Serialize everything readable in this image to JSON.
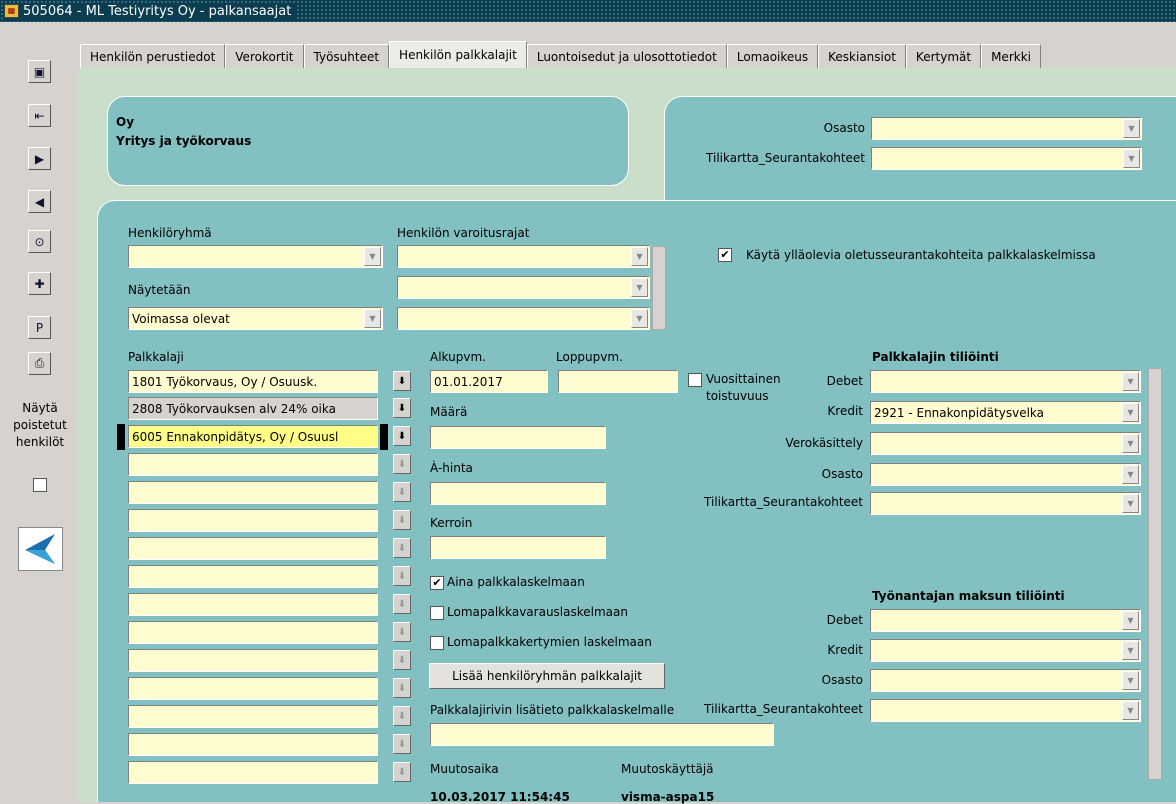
{
  "window": {
    "title": "505064 - ML Testiyritys Oy - palkansaajat"
  },
  "tabs": [
    "Henkilön perustiedot",
    "Verokortit",
    "Työsuhteet",
    "Henkilön palkkalajit",
    "Luontoisedut ja ulosottotiedot",
    "Lomaoikeus",
    "Keskiansiot",
    "Kertymät",
    "Merkki"
  ],
  "toolbar": {
    "icons": [
      "save-icon",
      "exit-icon",
      "next-icon",
      "previous-icon",
      "query-icon",
      "new-record-icon",
      "p-icon",
      "print-icon"
    ],
    "p_label": "P"
  },
  "left": {
    "show_deleted_line1": "Näytä",
    "show_deleted_line2": "poistetut",
    "show_deleted_line3": "henkilöt"
  },
  "company": {
    "line1": "Oy",
    "line2": "Yritys ja työkorvaus"
  },
  "header_right": {
    "osasto_label": "Osasto",
    "osasto_value": "",
    "tilikartta_label": "Tilikartta_Seurantakohteet",
    "tilikartta_value": ""
  },
  "filters": {
    "henkiloryhma_label": "Henkilöryhmä",
    "henkiloryhma_value": "",
    "varoitusrajat_label": "Henkilön varoitusrajat",
    "naytetaan_label": "Näytetään",
    "naytetaan_value": "Voimassa olevat",
    "use_defaults_label": "Käytä ylläolevia oletusseurantakohteita palkkalaskelmissa",
    "use_defaults_checked": true
  },
  "palkkalaji": {
    "label": "Palkkalaji",
    "rows": [
      "1801 Työkorvaus, Oy / Osuusk.",
      "2808 Työkorvauksen alv 24% oika",
      "6005 Ennakonpidätys, Oy / Osuusl",
      "",
      "",
      "",
      "",
      "",
      "",
      "",
      "",
      "",
      "",
      "",
      ""
    ]
  },
  "detail": {
    "alkupvm_label": "Alkupvm.",
    "alkupvm_value": "01.01.2017",
    "loppupvm_label": "Loppupvm.",
    "loppupvm_value": "",
    "vuosittainen_label1": "Vuosittainen",
    "vuosittainen_label2": "toistuvuus",
    "maara_label": "Määrä",
    "ahinta_label": "À-hinta",
    "kerroin_label": "Kerroin",
    "aina_label": "Aina palkkalaskelmaan",
    "aina_checked": true,
    "lomapalkkavaraus_label": "Lomapalkkavarauslaskelmaan",
    "lomapalkkakertymien_label": "Lomapalkkakertymien laskelmaan",
    "add_button": "Lisää henkilöryhmän palkkalajit",
    "lisatieto_label": "Palkkalajirivin lisätieto palkkalaskelmalle",
    "muutosaika_label": "Muutosaika",
    "muutosaika_value": "10.03.2017 11:54:45",
    "muutoskayttaja_label": "Muutoskäyttäjä",
    "muutoskayttaja_value": "visma-aspa15"
  },
  "tiliointi": {
    "title": "Palkkalajin tiliöinti",
    "debet_label": "Debet",
    "debet_value": "",
    "kredit_label": "Kredit",
    "kredit_value": "2921 - Ennakonpidätysvelka",
    "verokasittely_label": "Verokäsittely",
    "osasto_label": "Osasto",
    "tilikartta_label": "Tilikartta_Seurantakohteet"
  },
  "tyonantaja": {
    "title": "Työnantajan maksun tiliöinti",
    "debet_label": "Debet",
    "kredit_label": "Kredit",
    "osasto_label": "Osasto",
    "tilikartta_label": "Tilikartta_Seurantakohteet"
  }
}
